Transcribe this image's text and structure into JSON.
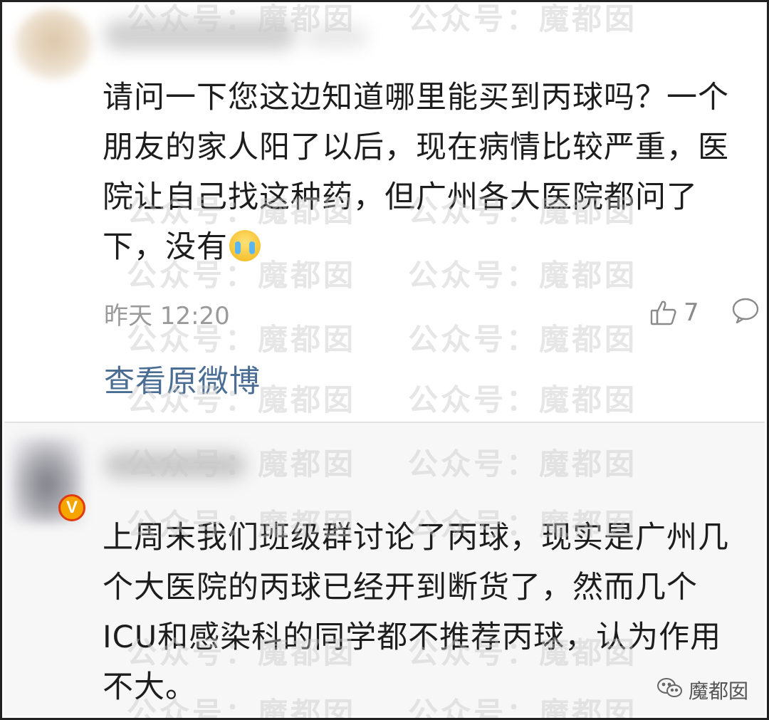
{
  "comment1": {
    "text": "请问一下您这边知道哪里能买到丙球吗？一个朋友的家人阳了以后，现在病情比较严重，医院让自己找这种药，但广州各大医院都问了下，没有",
    "emoji": "crying-emoji",
    "time": "昨天 12:20",
    "likes": "7",
    "view_original": "查看原微博"
  },
  "comment2": {
    "badge": "V",
    "text": "上周末我们班级群讨论了丙球，现实是广州几个大医院的丙球已经开到断货了，然而几个ICU和感染科的同学都不推荐丙球，认为作用不大。"
  },
  "watermark": "公众号：魔都囡",
  "brand": "魔都囡",
  "colors": {
    "link": "#4a6d93",
    "meta": "#9a9a9a",
    "text": "#1d1d1d",
    "reply_bg": "#f7f7f7"
  }
}
